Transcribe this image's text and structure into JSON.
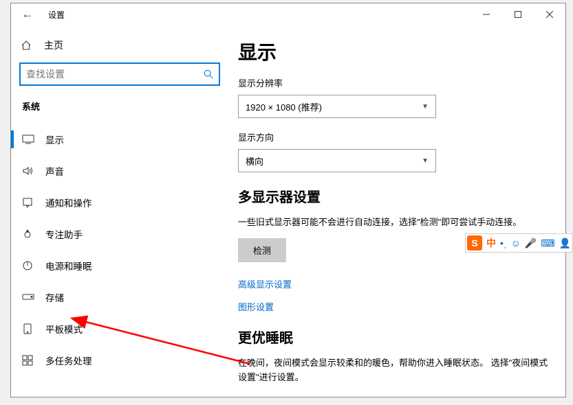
{
  "window": {
    "title": "设置"
  },
  "sidebar": {
    "home": "主页",
    "search_placeholder": "查找设置",
    "section": "系统",
    "items": [
      {
        "label": "显示"
      },
      {
        "label": "声音"
      },
      {
        "label": "通知和操作"
      },
      {
        "label": "专注助手"
      },
      {
        "label": "电源和睡眠"
      },
      {
        "label": "存储"
      },
      {
        "label": "平板模式"
      },
      {
        "label": "多任务处理"
      }
    ]
  },
  "content": {
    "heading": "显示",
    "resolution_label": "显示分辨率",
    "resolution_value": "1920 × 1080 (推荐)",
    "orientation_label": "显示方向",
    "orientation_value": "横向",
    "multi_heading": "多显示器设置",
    "multi_desc": "一些旧式显示器可能不会进行自动连接，选择\"检测\"即可尝试手动连接。",
    "detect_btn": "检测",
    "adv_link": "高级显示设置",
    "gfx_link": "图形设置",
    "sleep_heading": "更优睡眠",
    "sleep_desc": "在晚间，夜间模式会显示较柔和的暖色，帮助你进入睡眠状态。 选择\"夜间模式设置\"进行设置。"
  },
  "ime": {
    "badge": "S",
    "lang": "中"
  }
}
